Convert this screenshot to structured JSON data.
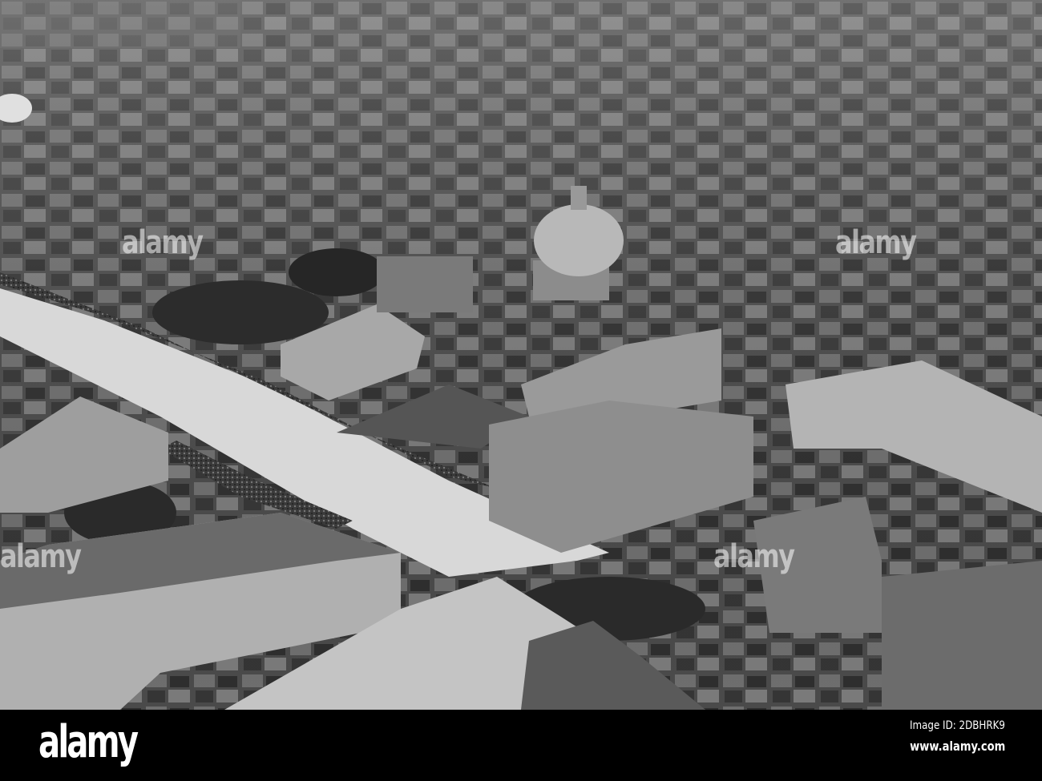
{
  "photo": {
    "subject": "Aerial photograph of a city boulevard with crowds, domed church and surrounding buildings",
    "watermark_text": "alamy"
  },
  "footer": {
    "logo": "alamy",
    "image_id": "Image ID: 2DBHRK9",
    "website": "www.alamy.com"
  },
  "colors": {
    "footer_bg": "#000000",
    "footer_text": "#ffffff"
  }
}
